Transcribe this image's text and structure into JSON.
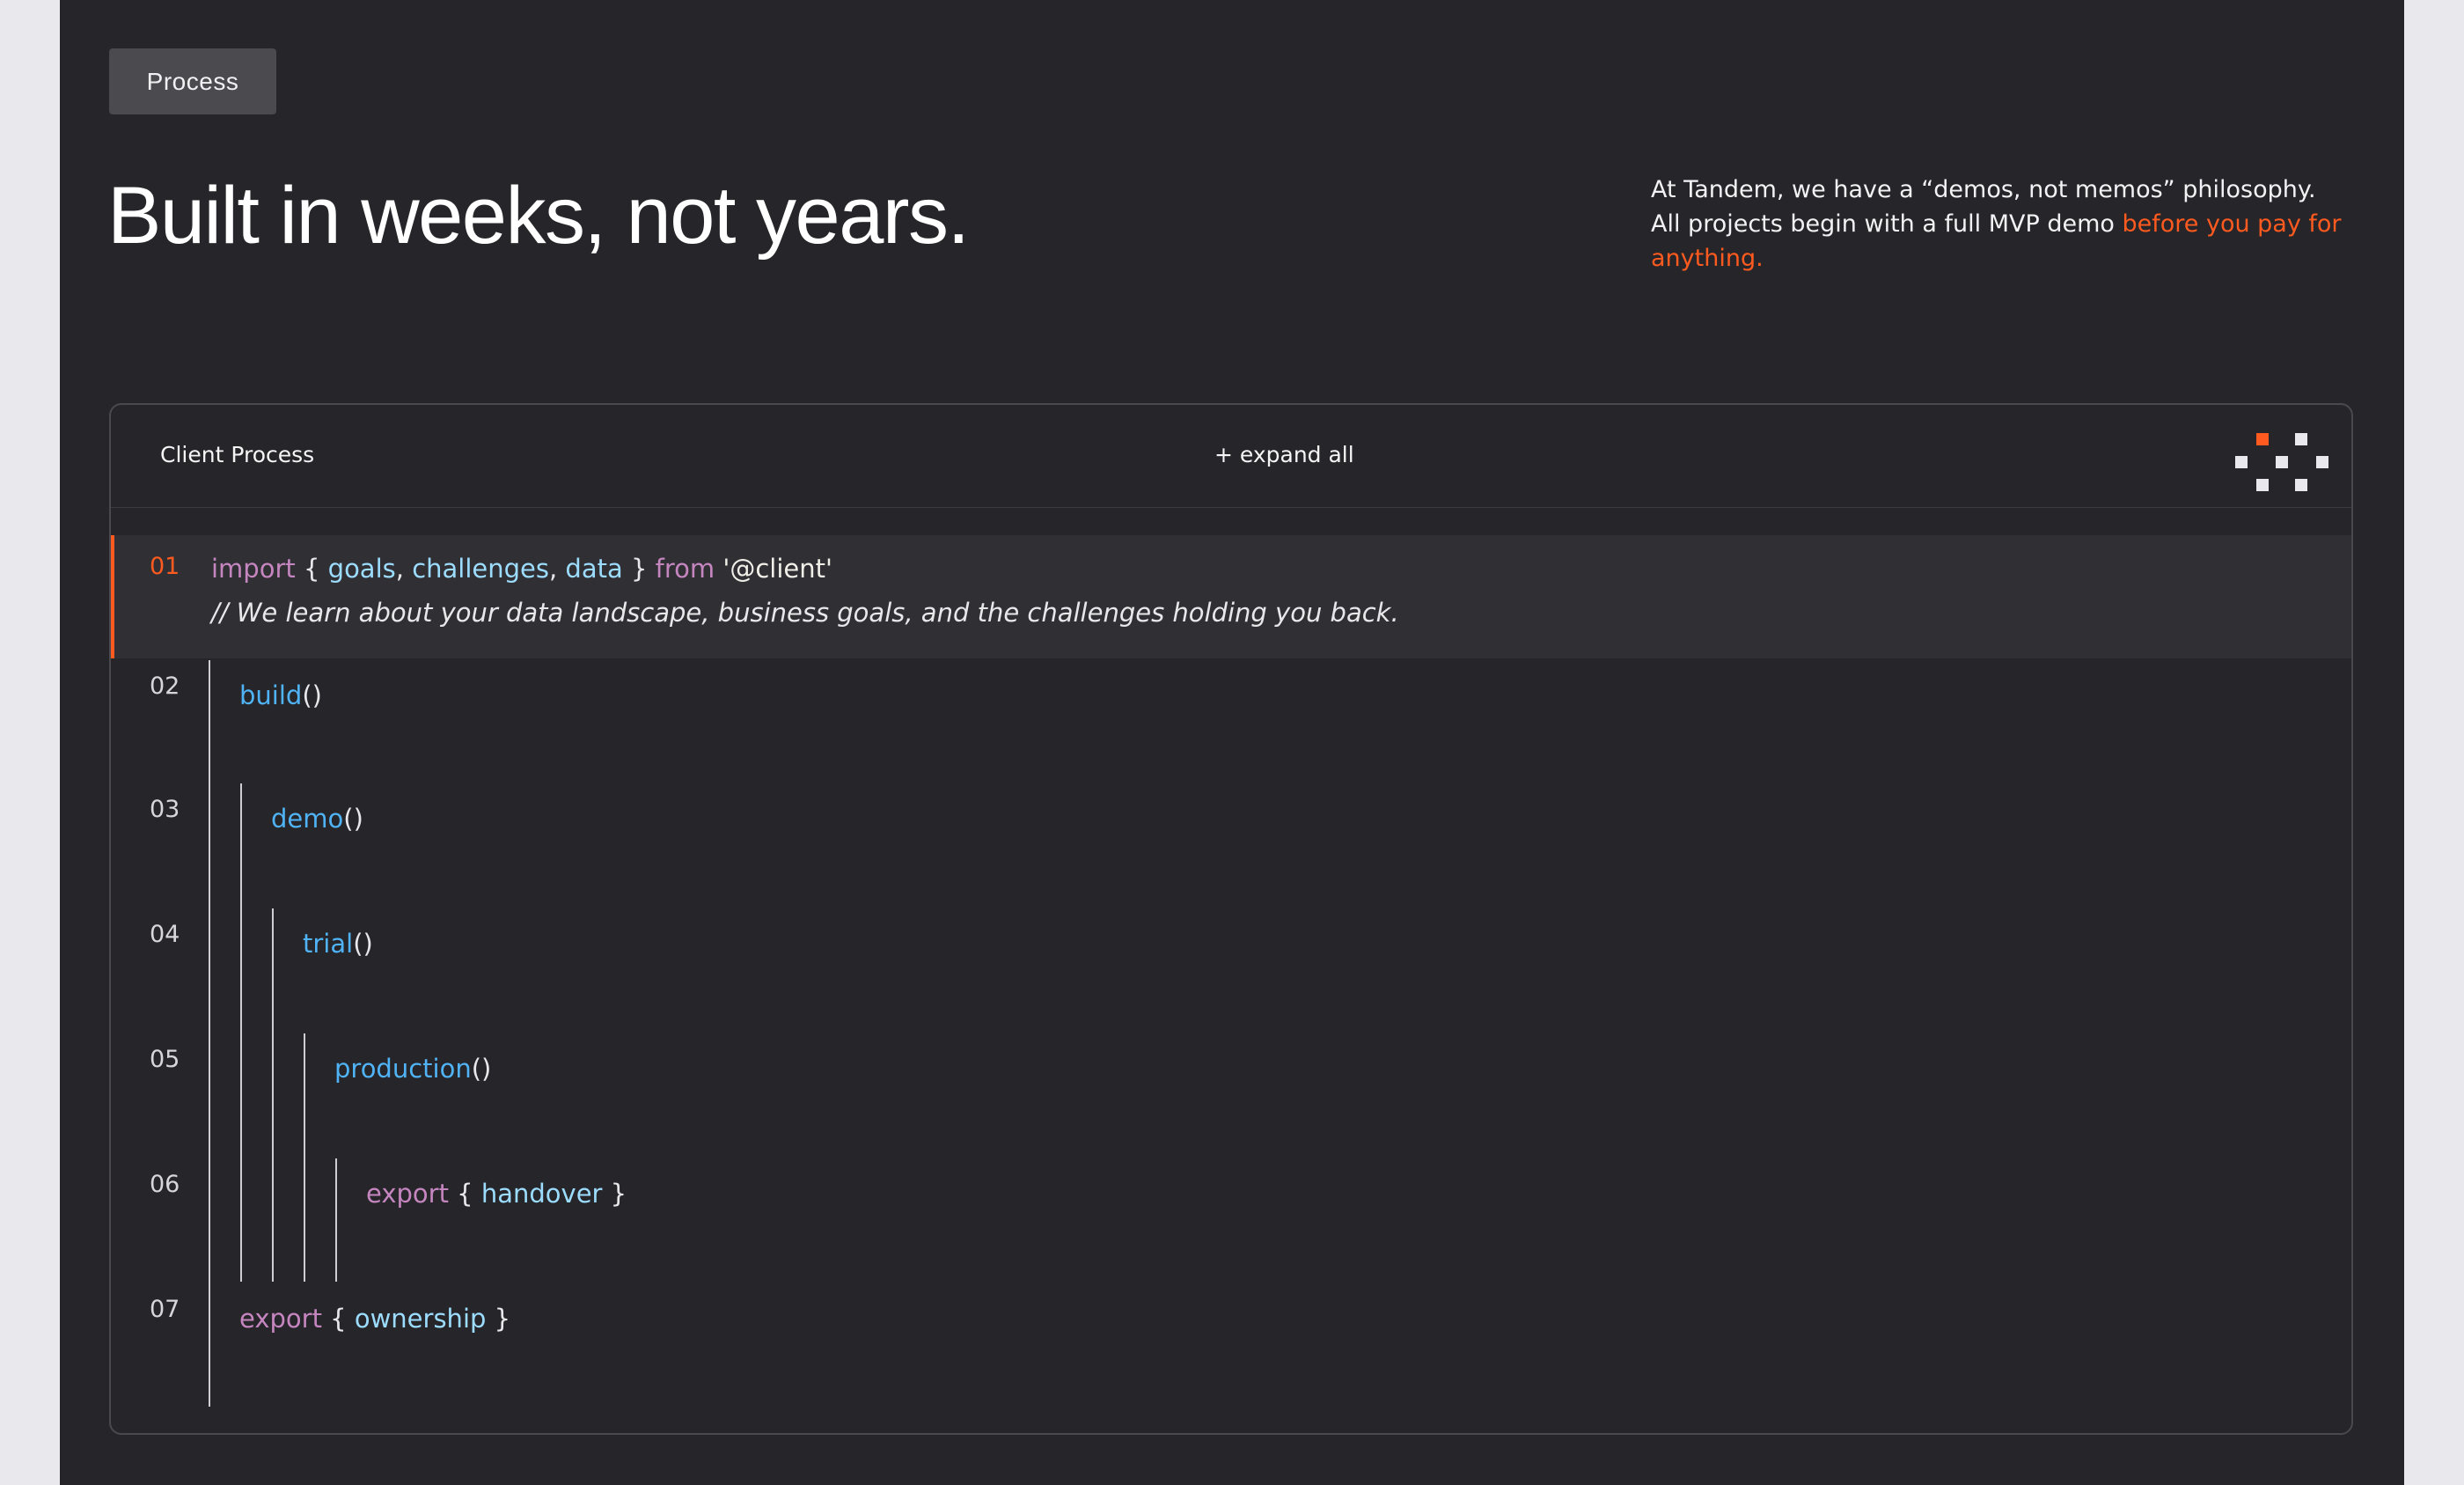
{
  "tag": "Process",
  "title": "Built in weeks, not years.",
  "intro": {
    "line1": "At Tandem, we have a “demos, not memos” philosophy.",
    "line2_prefix": "All projects begin with a full MVP demo ",
    "highlight": "before you pay for anything."
  },
  "card": {
    "label": "Client Process",
    "expand_label": "+ expand all",
    "steps": [
      {
        "num": "01",
        "import_kw": "import",
        "open": "{ ",
        "goals": "goals",
        "sep1": ", ",
        "challenges": "challenges",
        "sep2": ", ",
        "data": "data",
        "close": " }",
        "from_kw": "from",
        "module": "'@client'",
        "comment": "// We learn about your data landscape, business goals, and the challenges holding you back."
      },
      {
        "num": "02",
        "fn": "build",
        "parens": "()"
      },
      {
        "num": "03",
        "fn": "demo",
        "parens": "()"
      },
      {
        "num": "04",
        "fn": "trial",
        "parens": "()"
      },
      {
        "num": "05",
        "fn": "production",
        "parens": "()"
      },
      {
        "num": "06",
        "kw": "export",
        "open": "{ ",
        "name": "handover",
        "close": " }"
      },
      {
        "num": "07",
        "kw": "export",
        "open": "{ ",
        "name": "ownership",
        "close": " }"
      }
    ]
  },
  "colors": {
    "background": "#262529",
    "accent": "#ff5a1f",
    "keyword": "#c586c0",
    "function": "#4fb3f6",
    "variable": "#9cdcfe"
  }
}
